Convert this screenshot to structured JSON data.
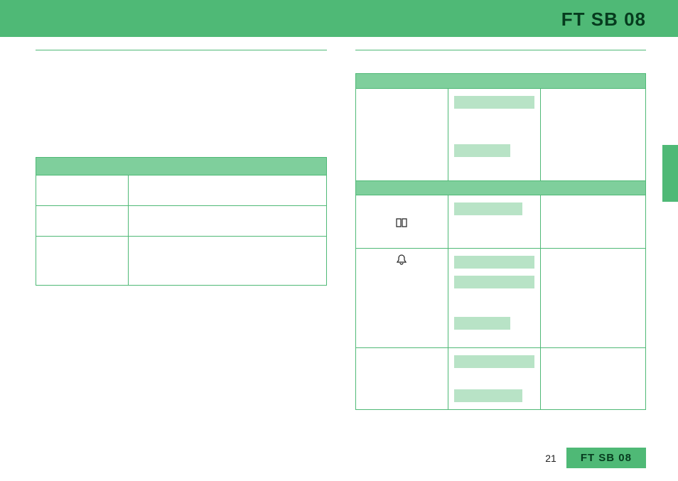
{
  "header": {
    "title": "FT SB 08"
  },
  "leftTable": {
    "rows": [
      {
        "a": "",
        "b": ""
      },
      {
        "a": "",
        "b": ""
      },
      {
        "a": "",
        "b": ""
      }
    ]
  },
  "rightTable": {
    "section1": {
      "rows": [
        {
          "icon": "",
          "chips": [
            "",
            ""
          ],
          "note": ""
        }
      ]
    },
    "section2": {
      "rows": [
        {
          "icon": "book",
          "chips": [
            ""
          ],
          "note": ""
        },
        {
          "icon": "bell",
          "chips": [
            "",
            "",
            ""
          ],
          "note": ""
        },
        {
          "icon": "",
          "chips": [
            "",
            ""
          ],
          "note": ""
        }
      ]
    }
  },
  "icons": {
    "book": "📖",
    "bell": "🔔"
  },
  "footer": {
    "page": "21",
    "label": "FT SB 08"
  },
  "colors": {
    "brand": "#4fb976",
    "brandLight": "#7fcf9c",
    "chip": "#b8e3c6",
    "dark": "#063b1e"
  }
}
